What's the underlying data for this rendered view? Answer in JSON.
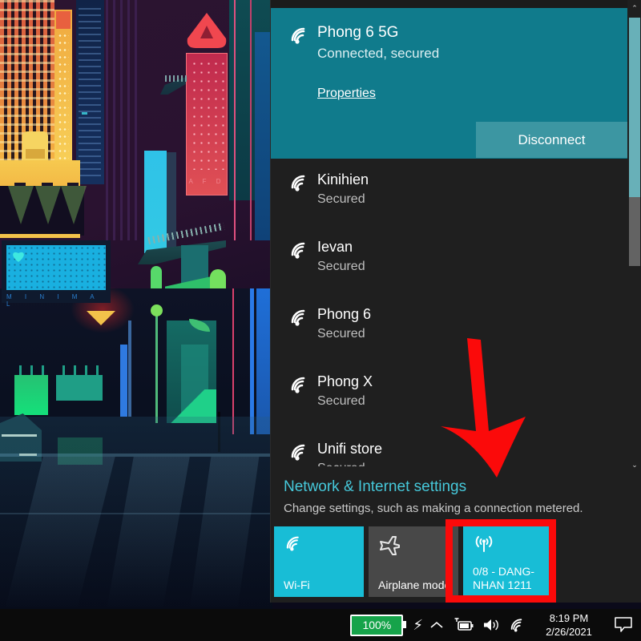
{
  "wallpaper": {
    "label": "neon-cyberpunk-city-wallpaper",
    "sign_text": "A F D",
    "minimal_text": "M I N I M A L"
  },
  "panel": {
    "connected_network": {
      "ssid": "Phong 6 5G",
      "status": "Connected, secured",
      "properties_link": "Properties",
      "disconnect_button": "Disconnect",
      "icon": "wifi-icon"
    },
    "networks": [
      {
        "ssid": "Kinihien",
        "status": "Secured",
        "icon": "wifi-icon"
      },
      {
        "ssid": "Ievan",
        "status": "Secured",
        "icon": "wifi-icon"
      },
      {
        "ssid": "Phong 6",
        "status": "Secured",
        "icon": "wifi-icon"
      },
      {
        "ssid": "Phong X",
        "status": "Secured",
        "icon": "wifi-icon"
      },
      {
        "ssid": "Unifi store",
        "status": "Secured",
        "icon": "wifi-icon"
      }
    ],
    "settings": {
      "link": "Network & Internet settings",
      "description": "Change settings, such as making a connection metered.",
      "link_color": "#46c8da"
    },
    "tiles": [
      {
        "label": "Wi-Fi",
        "icon": "wifi-icon",
        "state": "on",
        "accent": "#18bdd6"
      },
      {
        "label": "Airplane mode",
        "icon": "airplane-icon",
        "state": "off",
        "accent": "#484848"
      },
      {
        "label": "0/8 - DANG-\nNHAN 1211",
        "icon": "hotspot-icon",
        "state": "on",
        "accent": "#18bdd6"
      }
    ],
    "scrollbar": {
      "up": "⌃",
      "down": "⌄"
    },
    "accent_color": "#107b8c"
  },
  "annotations": {
    "arrow_color": "#fb0a0a",
    "rect_color": "#fb0a0a",
    "arrow_name": "red-down-arrow",
    "rect_name": "red-highlight-rectangle"
  },
  "taskbar": {
    "battery_percent": "100%",
    "battery_color": "#16a34a",
    "icons": [
      "charging-bolt-icon",
      "chevron-up-icon",
      "battery-charging-icon",
      "speaker-icon",
      "wifi-icon"
    ],
    "time": "8:19 PM",
    "date": "2/26/2021",
    "action_center_icon": "action-center-icon"
  }
}
